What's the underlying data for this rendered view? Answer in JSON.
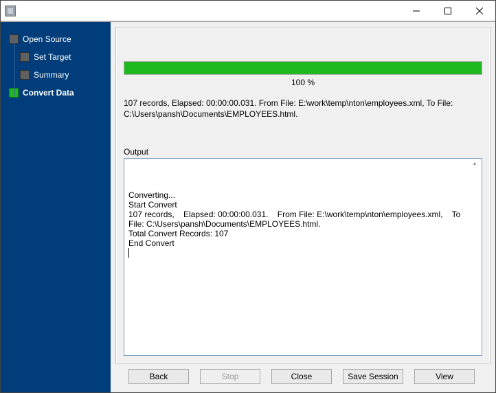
{
  "window": {
    "title": ""
  },
  "sidebar": {
    "items": [
      {
        "label": "Open Source",
        "active": false
      },
      {
        "label": "Set Target",
        "active": false
      },
      {
        "label": "Summary",
        "active": false
      },
      {
        "label": "Convert Data",
        "active": true
      }
    ]
  },
  "progress": {
    "percent": 100,
    "label": "100 %"
  },
  "status": {
    "line1": "107 records,    Elapsed: 00:00:00.031.    From File: E:\\work\\temp\\nton\\employees.xml,    To File:",
    "line2": "C:\\Users\\pansh\\Documents\\EMPLOYEES.html."
  },
  "output": {
    "label": "Output",
    "lines": [
      "Converting...",
      "Start Convert",
      "107 records,    Elapsed: 00:00:00.031.    From File: E:\\work\\temp\\nton\\employees.xml,    To File: C:\\Users\\pansh\\Documents\\EMPLOYEES.html.",
      "Total Convert Records: 107",
      "End Convert"
    ]
  },
  "buttons": {
    "back": "Back",
    "stop": "Stop",
    "close": "Close",
    "save_session": "Save Session",
    "view": "View"
  }
}
